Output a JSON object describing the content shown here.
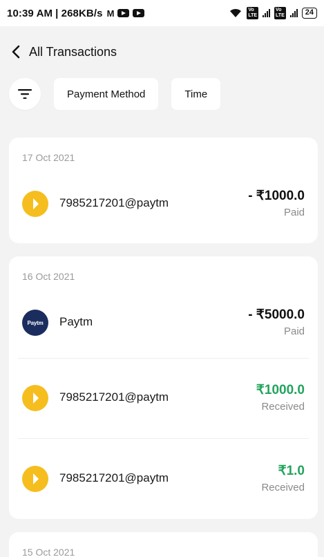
{
  "status_bar": {
    "time": "10:39 AM",
    "speed": "| 268KB/s",
    "mail_icon": "M",
    "battery": "24",
    "network": "4G"
  },
  "header": {
    "title": "All Transactions"
  },
  "filters": {
    "payment_method": "Payment Method",
    "time": "Time"
  },
  "groups": [
    {
      "date": "17 Oct 2021",
      "transactions": [
        {
          "name": "7985217201@paytm",
          "amount": "- ₹1000.0",
          "status": "Paid",
          "logo": "paytm-upi-yellow"
        }
      ]
    },
    {
      "date": "16 Oct 2021",
      "transactions": [
        {
          "name": "Paytm",
          "amount": "- ₹5000.0",
          "status": "Paid",
          "logo": "paytm-navy",
          "logo_text": "Paytm"
        },
        {
          "name": "7985217201@paytm",
          "amount": "₹1000.0",
          "status": "Received",
          "logo": "paytm-upi-yellow"
        },
        {
          "name": "7985217201@paytm",
          "amount": "₹1.0",
          "status": "Received",
          "logo": "paytm-upi-yellow"
        }
      ]
    },
    {
      "date": "15 Oct 2021"
    }
  ],
  "colors": {
    "background": "#f3f3f3",
    "received": "#22a45d",
    "upi_logo": "#f5be1e",
    "paytm_logo": "#1b2d5e"
  }
}
